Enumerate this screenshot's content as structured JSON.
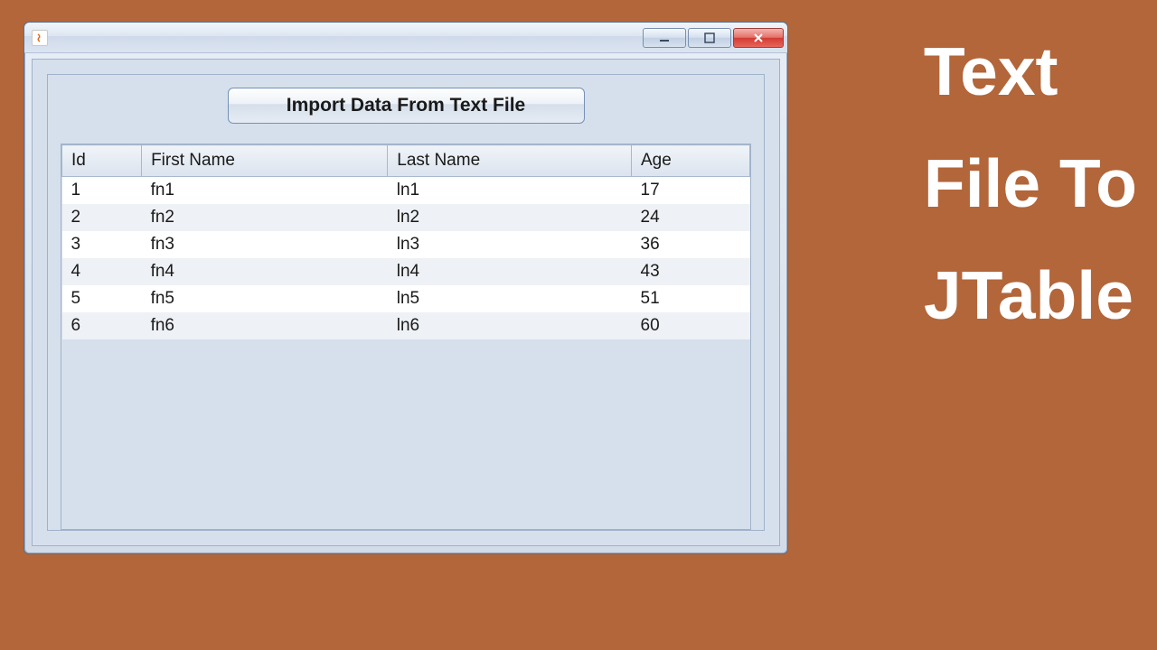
{
  "sidebar": {
    "line1": "Text",
    "line2": "File To",
    "line3": "JTable"
  },
  "window": {
    "controls": {
      "minimize": "—",
      "maximize": "□",
      "close": "X"
    }
  },
  "button": {
    "import_label": "Import Data From Text File"
  },
  "table": {
    "headers": [
      "Id",
      "First Name",
      "Last Name",
      "Age"
    ],
    "rows": [
      [
        "1",
        "fn1",
        "ln1",
        "17"
      ],
      [
        "2",
        "fn2",
        "ln2",
        "24"
      ],
      [
        "3",
        "fn3",
        "ln3",
        "36"
      ],
      [
        "4",
        "fn4",
        "ln4",
        "43"
      ],
      [
        "5",
        "fn5",
        "ln5",
        "51"
      ],
      [
        "6",
        "fn6",
        "ln6",
        "60"
      ]
    ]
  }
}
